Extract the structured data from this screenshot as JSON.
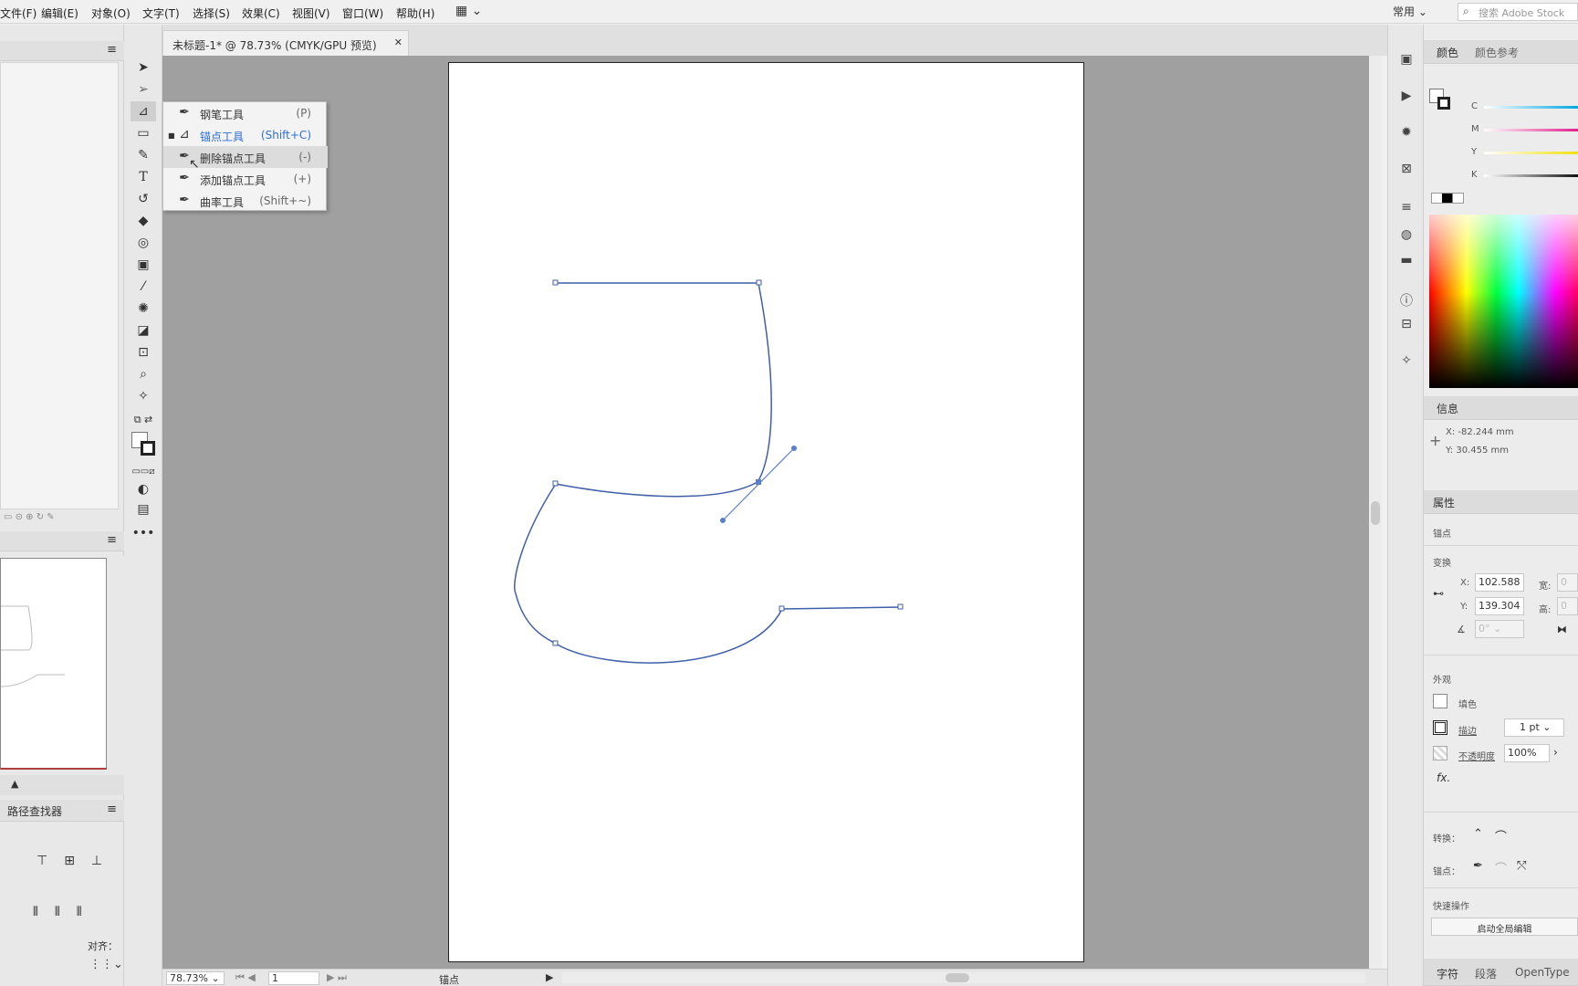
{
  "menu": {
    "items": [
      "文件(F)",
      "编辑(E)",
      "对象(O)",
      "文字(T)",
      "选择(S)",
      "效果(C)",
      "视图(V)",
      "窗口(W)",
      "帮助(H)"
    ],
    "workspace": "常用",
    "search_placeholder": "搜索 Adobe Stock"
  },
  "document": {
    "tab_title": "未标题-1* @ 78.73% (CMYK/GPU 预览)",
    "close_glyph": "✕"
  },
  "flyout": {
    "items": [
      {
        "label": "钢笔工具",
        "key": "(P)"
      },
      {
        "label": "锚点工具",
        "key": "(Shift+C)"
      },
      {
        "label": "删除锚点工具",
        "key": "(-)"
      },
      {
        "label": "添加锚点工具",
        "key": "(+)"
      },
      {
        "label": "曲率工具",
        "key": "(Shift+~)"
      }
    ],
    "selected_index": 1,
    "hover_index": 2
  },
  "left_panel": {
    "pathfinder_title": "路径查找器",
    "align_label": "对齐："
  },
  "status": {
    "zoom": "78.73%",
    "page": "1",
    "tool": "锚点"
  },
  "right_panel": {
    "color_tabs": [
      "颜色",
      "颜色参考"
    ],
    "cmyk_labels": [
      "C",
      "M",
      "Y",
      "K"
    ],
    "info": {
      "title": "信息",
      "x": "X: -82.244 mm",
      "y": "Y: 30.455 mm"
    },
    "properties": {
      "tab": "属性",
      "selection": "锚点",
      "transform_title": "变换",
      "x_label": "X:",
      "x_value": "102.588",
      "y_label": "Y:",
      "y_value": "139.304",
      "w_label": "宽:",
      "h_label": "高:",
      "angle": "0°",
      "appearance_title": "外观",
      "fill_label": "填色",
      "stroke_label": "描边",
      "stroke_value": "1 pt",
      "opacity_label": "不透明度",
      "opacity_value": "100%",
      "fx": "fx.",
      "convert_label": "转换：",
      "anchor_label": "锚点：",
      "quick_title": "快速操作",
      "global_edit": "启动全局编辑"
    },
    "bottom_tabs": [
      "字符",
      "段落",
      "OpenType"
    ]
  },
  "colors": {
    "path_stroke": "#3f5fa8",
    "selection_blue": "#2d6fd6",
    "canvas_bg": "#a0a0a0"
  }
}
